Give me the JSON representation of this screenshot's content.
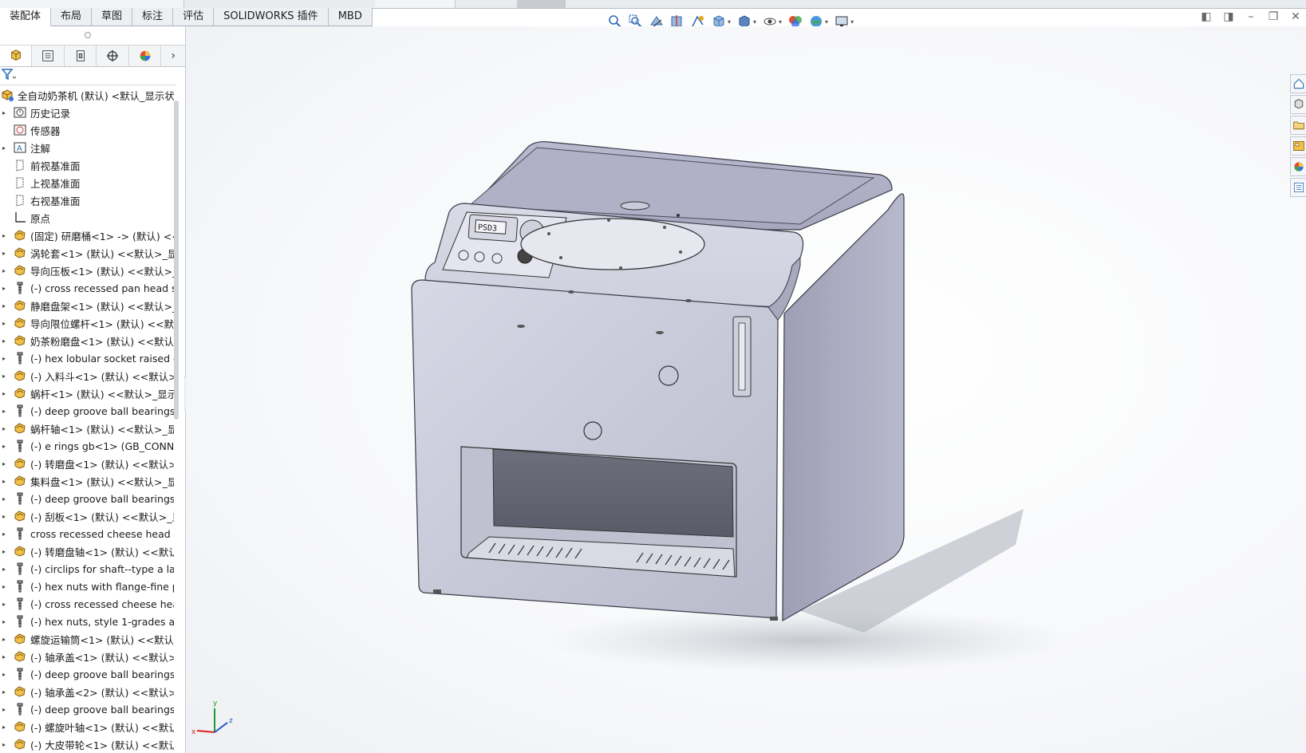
{
  "command_tabs": [
    "装配体",
    "布局",
    "草图",
    "标注",
    "评估",
    "SOLIDWORKS 插件",
    "MBD"
  ],
  "active_command_tab": 0,
  "view_tools": [
    {
      "icon": "zoom-to-fit-icon"
    },
    {
      "icon": "zoom-to-area-icon"
    },
    {
      "icon": "previous-view-icon"
    },
    {
      "icon": "section-view-icon"
    },
    {
      "icon": "dynamic-annotation-icon"
    },
    {
      "icon": "view-orientation-icon",
      "dropdown": true
    },
    {
      "icon": "display-style-icon",
      "dropdown": true
    },
    {
      "icon": "hide-show-icon",
      "dropdown": true
    },
    {
      "icon": "edit-appearance-icon"
    },
    {
      "icon": "apply-scene-icon",
      "dropdown": true
    },
    {
      "icon": "view-settings-icon",
      "dropdown": true
    }
  ],
  "window_controls": [
    "restore-left-icon",
    "restore-right-icon",
    "minimize-icon",
    "maximize-icon",
    "close-icon"
  ],
  "manager_tabs": [
    {
      "icon": "feature-manager-icon"
    },
    {
      "icon": "property-manager-icon"
    },
    {
      "icon": "configuration-manager-icon"
    },
    {
      "icon": "dimxpert-icon"
    },
    {
      "icon": "display-manager-icon"
    }
  ],
  "feature_tree": [
    {
      "label": "全自动奶茶机 (默认) <默认_显示状态",
      "icon": "assembly",
      "expand": ""
    },
    {
      "label": "历史记录",
      "icon": "history",
      "expand": "▸"
    },
    {
      "label": "传感器",
      "icon": "sensor",
      "expand": ""
    },
    {
      "label": "注解",
      "icon": "annotation",
      "expand": "▸"
    },
    {
      "label": "前视基准面",
      "icon": "plane",
      "expand": ""
    },
    {
      "label": "上视基准面",
      "icon": "plane",
      "expand": ""
    },
    {
      "label": "右视基准面",
      "icon": "plane",
      "expand": ""
    },
    {
      "label": "原点",
      "icon": "origin",
      "expand": ""
    },
    {
      "label": "(固定) 研磨桶<1> -> (默认) <<",
      "icon": "part",
      "expand": "▸"
    },
    {
      "label": "涡轮套<1> (默认) <<默认>_显示",
      "icon": "part",
      "expand": "▸"
    },
    {
      "label": "导向压板<1> (默认) <<默认>_显",
      "icon": "part",
      "expand": "▸"
    },
    {
      "label": "(-) cross recessed pan head s",
      "icon": "fastener",
      "expand": "▸"
    },
    {
      "label": "静磨盘架<1> (默认) <<默认>_显",
      "icon": "part",
      "expand": "▸"
    },
    {
      "label": "导向限位螺杆<1> (默认) <<默认",
      "icon": "part",
      "expand": "▸"
    },
    {
      "label": "奶茶粉磨盘<1> (默认) <<默认>",
      "icon": "part",
      "expand": "▸"
    },
    {
      "label": "(-) hex lobular socket raised c",
      "icon": "fastener",
      "expand": "▸"
    },
    {
      "label": "(-) 入料斗<1> (默认) <<默认>_",
      "icon": "part",
      "expand": "▸"
    },
    {
      "label": "蜗杆<1> (默认) <<默认>_显示状",
      "icon": "part",
      "expand": "▸"
    },
    {
      "label": "(-) deep groove ball bearings",
      "icon": "fastener",
      "expand": "▸"
    },
    {
      "label": "蜗杆轴<1> (默认) <<默认>_显示",
      "icon": "part",
      "expand": "▸"
    },
    {
      "label": "(-) e rings gb<1> (GB_CONNE",
      "icon": "fastener",
      "expand": "▸"
    },
    {
      "label": "(-) 转磨盘<1> (默认) <<默认>_",
      "icon": "part",
      "expand": "▸"
    },
    {
      "label": "集料盘<1> (默认) <<默认>_显示",
      "icon": "part",
      "expand": "▸"
    },
    {
      "label": "(-) deep groove ball bearings",
      "icon": "fastener",
      "expand": "▸"
    },
    {
      "label": "(-) 刮板<1> (默认) <<默认>_显",
      "icon": "part",
      "expand": "▸"
    },
    {
      "label": "cross recessed cheese head s",
      "icon": "fastener",
      "expand": "▸"
    },
    {
      "label": "(-) 转磨盘轴<1> (默认) <<默认",
      "icon": "part",
      "expand": "▸"
    },
    {
      "label": "(-) circlips for shaft--type a lar",
      "icon": "fastener",
      "expand": "▸"
    },
    {
      "label": "(-) hex nuts with flange-fine pi",
      "icon": "fastener",
      "expand": "▸"
    },
    {
      "label": "(-) cross recessed cheese hea",
      "icon": "fastener",
      "expand": "▸"
    },
    {
      "label": "(-) hex nuts, style 1-grades ab",
      "icon": "fastener",
      "expand": "▸"
    },
    {
      "label": "螺旋运输筒<1> (默认) <<默认>",
      "icon": "part",
      "expand": "▸"
    },
    {
      "label": "(-) 轴承盖<1> (默认) <<默认>_",
      "icon": "part",
      "expand": "▸"
    },
    {
      "label": "(-) deep groove ball bearings",
      "icon": "fastener",
      "expand": "▸"
    },
    {
      "label": "(-) 轴承盖<2> (默认) <<默认>_",
      "icon": "part",
      "expand": "▸"
    },
    {
      "label": "(-) deep groove ball bearings",
      "icon": "fastener",
      "expand": "▸"
    },
    {
      "label": "(-) 螺旋叶轴<1> (默认) <<默认",
      "icon": "part",
      "expand": "▸"
    },
    {
      "label": "(-) 大皮带轮<1> (默认) <<默认",
      "icon": "part",
      "expand": "▸"
    }
  ],
  "task_pane": [
    "home-icon",
    "design-library-icon",
    "file-explorer-icon",
    "view-palette-icon",
    "appearances-icon",
    "custom-properties-icon"
  ],
  "triad": {
    "x": "x",
    "y": "y",
    "z": "z"
  },
  "model_panel": {
    "display": "PSD3"
  },
  "colors": {
    "accent": "#f2b01e",
    "body": "#c9cad8",
    "body_dark": "#8d8ea3"
  }
}
